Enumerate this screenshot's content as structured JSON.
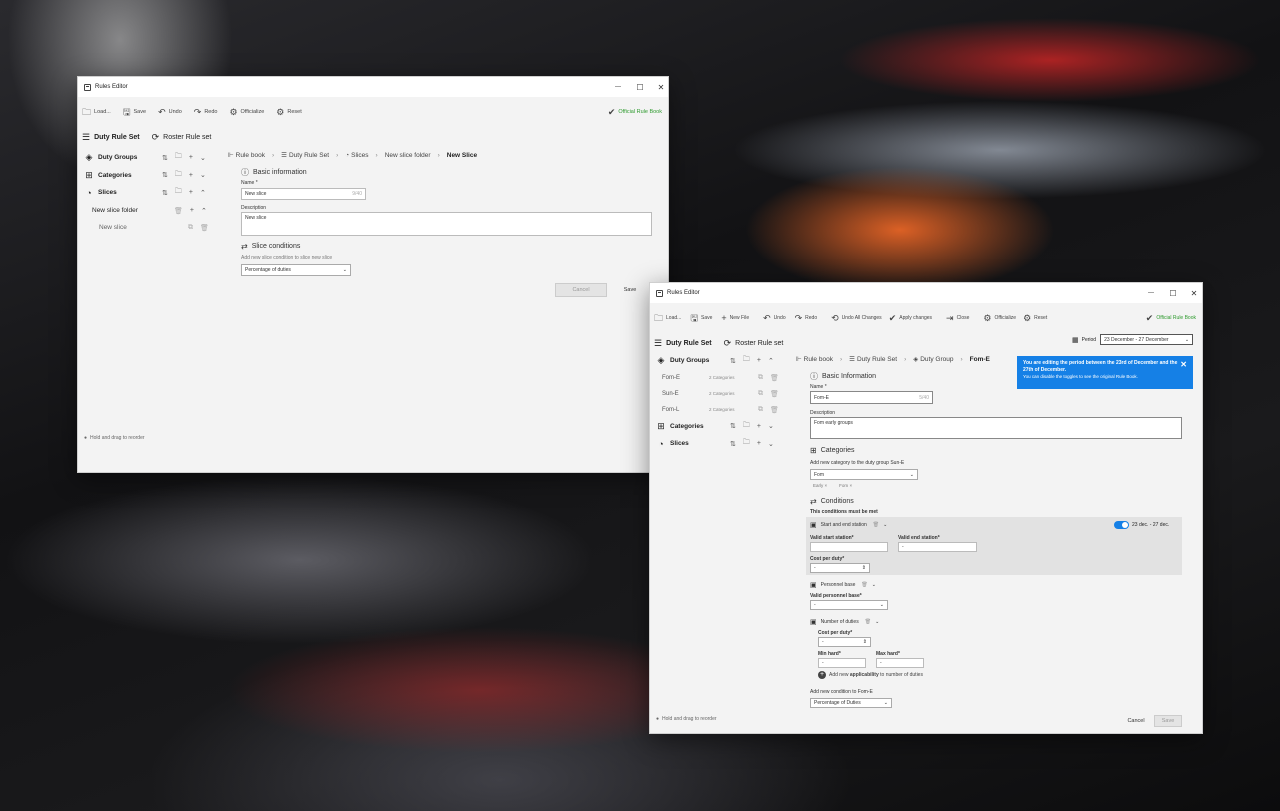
{
  "window1": {
    "title": "Rules Editor",
    "controls": {
      "minimize": "—",
      "maximize": "☐",
      "close": "✕"
    },
    "toolbar": {
      "load": "Load...",
      "save": "Save",
      "undo": "Undo",
      "redo": "Redo",
      "officialize": "Officialize",
      "reset": "Reset",
      "official": "Official Rule Book"
    },
    "tabs": {
      "duty_rule_set": "Duty Rule Set",
      "roster_rule_set": "Roster Rule set"
    },
    "sidebar": {
      "duty_groups": "Duty Groups",
      "categories": "Categories",
      "slices": "Slices",
      "folder": "New slice folder",
      "slice": "New slice"
    },
    "breadcrumb": {
      "rule_book": "Rule book",
      "duty_rule_set": "Duty Rule Set",
      "slices": "Slices",
      "folder": "New slice folder",
      "current": "New Slice"
    },
    "basic_info": "Basic information",
    "name_label": "Name *",
    "name_value": "New slice",
    "name_counter": "9/40",
    "description_label": "Description",
    "description_value": "New slice",
    "conditions_title": "Slice conditions",
    "add_condition_label": "Add new slice condition to slice new slice",
    "condition_select": "Percentage of duties",
    "cancel": "Cancel",
    "save_btn": "Save",
    "footer": "Hold and drag to reorder"
  },
  "window2": {
    "title": "Rules Editor",
    "controls": {
      "minimize": "—",
      "maximize": "☐",
      "close": "✕"
    },
    "toolbar": {
      "load": "Load...",
      "save": "Save",
      "new_file": "New File",
      "undo": "Undo",
      "redo": "Redo",
      "undo_all": "Undo All Changes",
      "apply": "Apply changes",
      "close": "Close",
      "officialize": "Officialize",
      "reset": "Reset",
      "official": "Official Rule Book"
    },
    "tabs": {
      "duty_rule_set": "Duty Rule Set",
      "roster_rule_set": "Roster Rule set"
    },
    "period_label": "Period",
    "period_value": "23 December - 27 December",
    "sidebar": {
      "duty_groups": "Duty Groups",
      "items": [
        {
          "name": "Fom-E",
          "count": "2 Categories"
        },
        {
          "name": "Sun-E",
          "count": "2 Categories"
        },
        {
          "name": "Fom-L",
          "count": "2 Categories"
        }
      ],
      "categories": "Categories",
      "slices": "Slices"
    },
    "breadcrumb": {
      "rule_book": "Rule book",
      "duty_rule_set": "Duty Rule Set",
      "duty_group": "Duty Group",
      "current": "Fom-E"
    },
    "toast": {
      "title": "You are editing the period between the 23rd of December and the 27th of December.",
      "body": "You can disable the toggles to see the original Rule Book."
    },
    "basic_info": "Basic Information",
    "name_label": "Name *",
    "name_value": "Fom-E",
    "name_counter": "5/40",
    "description_label": "Description",
    "description_value": "Fom early groups",
    "categories_title": "Categories",
    "add_category_label": "Add new category to the duty group Sun-E",
    "category_select": "Fom",
    "chips": [
      "Early",
      "Fom"
    ],
    "conditions_title": "Conditions",
    "conditions_sub": "This conditions must be met",
    "start_end": "Start and end station",
    "toggle_range": "23 dec. - 27 dec.",
    "valid_start": "Valid start station*",
    "valid_end": "Valid end station*",
    "cost_per_duty": "Cost per duty*",
    "personnel_base": "Personnel base",
    "valid_personnel": "Valid personnel base*",
    "number_of_duties": "Number of duties",
    "cost_per_duty2": "Cost per duty*",
    "min_hard": "Min hard*",
    "max_hard": "Max hard*",
    "dash": "-",
    "add_applicability_pre": "Add new ",
    "add_applicability_bold": "applicability",
    "add_applicability_post": " to number of duties",
    "add_condition_label": "Add new condition to Fom-E",
    "condition_select": "Percentage of Duties",
    "cancel": "Cancel",
    "save_btn": "Save",
    "footer": "Hold and drag to reorder"
  }
}
